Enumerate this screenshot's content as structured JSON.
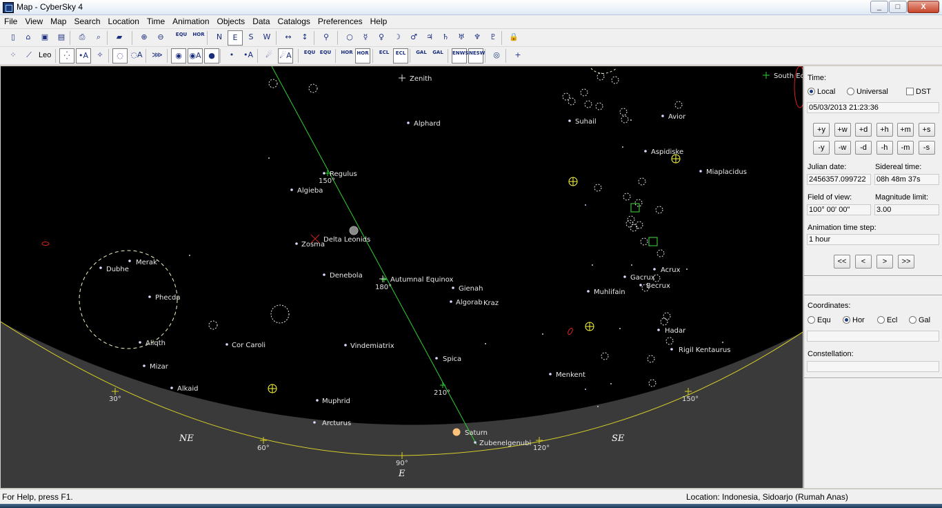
{
  "window": {
    "title": "Map - CyberSky 4",
    "minimize": "_",
    "maximize": "□",
    "close": "X"
  },
  "menu": [
    "File",
    "View",
    "Map",
    "Search",
    "Location",
    "Time",
    "Animation",
    "Objects",
    "Data",
    "Catalogs",
    "Preferences",
    "Help"
  ],
  "toolbar1": {
    "items": [
      {
        "name": "new-icon",
        "glyph": "▯"
      },
      {
        "name": "open-icon",
        "glyph": "⌂"
      },
      {
        "name": "save-icon",
        "glyph": "▣"
      },
      {
        "name": "save-all-icon",
        "glyph": "▤"
      },
      {
        "name": "print-icon",
        "glyph": "⎙"
      },
      {
        "name": "print-preview-icon",
        "glyph": "⌕"
      },
      {
        "name": "book-icon",
        "glyph": "▰"
      },
      {
        "name": "zoom-in-icon",
        "glyph": "⊕"
      },
      {
        "name": "zoom-out-icon",
        "glyph": "⊖"
      },
      {
        "name": "equ-dome-icon",
        "glyph": "EQU"
      },
      {
        "name": "hor-dome-icon",
        "glyph": "HOR"
      },
      {
        "name": "north-button",
        "glyph": "N"
      },
      {
        "name": "east-button",
        "glyph": "E"
      },
      {
        "name": "south-button",
        "glyph": "S"
      },
      {
        "name": "west-button",
        "glyph": "W"
      },
      {
        "name": "flip-horizontal-icon",
        "glyph": "↔"
      },
      {
        "name": "flip-vertical-icon",
        "glyph": "↕"
      },
      {
        "name": "telescope-icon",
        "glyph": "⚲"
      },
      {
        "name": "sun-icon",
        "glyph": "○"
      },
      {
        "name": "mercury-icon",
        "glyph": "☿"
      },
      {
        "name": "venus-icon",
        "glyph": "♀"
      },
      {
        "name": "moon-icon",
        "glyph": "☽"
      },
      {
        "name": "mars-icon",
        "glyph": "♂"
      },
      {
        "name": "jupiter-icon",
        "glyph": "♃"
      },
      {
        "name": "saturn-icon",
        "glyph": "♄"
      },
      {
        "name": "uranus-icon",
        "glyph": "♅"
      },
      {
        "name": "neptune-icon",
        "glyph": "♆"
      },
      {
        "name": "pluto-icon",
        "glyph": "♇"
      },
      {
        "name": "lock-icon",
        "glyph": "🔒"
      }
    ]
  },
  "toolbar2": {
    "constellation": "Leo",
    "items": [
      {
        "name": "constellation-lines-icon",
        "glyph": "⁘"
      },
      {
        "name": "constellation-line-icon",
        "glyph": "⟋"
      },
      {
        "name": "stars-icon",
        "glyph": "⁛"
      },
      {
        "name": "star-labels-icon",
        "glyph": "•A"
      },
      {
        "name": "star-names-icon",
        "glyph": "✧"
      },
      {
        "name": "deep-sky-icon",
        "glyph": "◌"
      },
      {
        "name": "deep-sky-labels-icon",
        "glyph": "◌A"
      },
      {
        "name": "milky-way-icon",
        "glyph": "⋙"
      },
      {
        "name": "planets-icon",
        "glyph": "◉"
      },
      {
        "name": "planet-labels-icon",
        "glyph": "◉A"
      },
      {
        "name": "planet-disk-icon",
        "glyph": "●"
      },
      {
        "name": "minor-planets-icon",
        "glyph": "•"
      },
      {
        "name": "minor-planet-labels-icon",
        "glyph": "•A"
      },
      {
        "name": "comets-icon",
        "glyph": "☄"
      },
      {
        "name": "comet-labels-icon",
        "glyph": "☄A"
      },
      {
        "name": "equ-grid-icon",
        "glyph": "EQU"
      },
      {
        "name": "equ-grid-labels-icon",
        "glyph": "EQU"
      },
      {
        "name": "hor-grid-icon",
        "glyph": "HOR"
      },
      {
        "name": "hor-grid-labels-icon",
        "glyph": "HOR"
      },
      {
        "name": "ecl-grid-icon",
        "glyph": "ECL"
      },
      {
        "name": "ecl-grid-labels-icon",
        "glyph": "ECL"
      },
      {
        "name": "gal-grid-icon",
        "glyph": "GAL"
      },
      {
        "name": "gal-grid-labels-icon",
        "glyph": "GAL"
      },
      {
        "name": "compass-icon",
        "glyph": "ENWS"
      },
      {
        "name": "nesw-labels-icon",
        "glyph": "NESW"
      },
      {
        "name": "target-icon",
        "glyph": "◎"
      },
      {
        "name": "crosshair-icon",
        "glyph": "+"
      }
    ]
  },
  "map": {
    "colors": {
      "sky": "#000000",
      "ground": "#3a3a3a",
      "horizon": "#d8d028",
      "ecliptic": "#2ed32e",
      "deepsky": "#ffffff",
      "marker": "#ffff40"
    },
    "stars": [
      {
        "name": "Zenith",
        "label": "Zenith"
      },
      {
        "name": "Alphard",
        "label": "Alphard"
      },
      {
        "name": "Regulus",
        "label": "Regulus"
      },
      {
        "name": "Algieba",
        "label": "Algieba"
      },
      {
        "name": "Zosma",
        "label": "Zosma"
      },
      {
        "name": "Delta Leonids",
        "label": "Delta Leonids"
      },
      {
        "name": "Merak",
        "label": "Merak"
      },
      {
        "name": "Dubhe",
        "label": "Dubhe"
      },
      {
        "name": "Phecda",
        "label": "Phecda"
      },
      {
        "name": "Denebola",
        "label": "Denebola"
      },
      {
        "name": "Autumnal Equinox",
        "label": "Autumnal Equinox"
      },
      {
        "name": "Gienah",
        "label": "Gienah"
      },
      {
        "name": "Algorab",
        "label": "Algorab"
      },
      {
        "name": "Kraz",
        "label": "Kraz"
      },
      {
        "name": "Alioth",
        "label": "Aliqth"
      },
      {
        "name": "Cor Caroli",
        "label": "Cor Caroli"
      },
      {
        "name": "Vindemiatrix",
        "label": "Vindemiatrix"
      },
      {
        "name": "Mizar",
        "label": "Mizar"
      },
      {
        "name": "Spica",
        "label": "Spica"
      },
      {
        "name": "Alkaid",
        "label": "Alkaid"
      },
      {
        "name": "Muphrid",
        "label": "Muphrid"
      },
      {
        "name": "Arcturus",
        "label": "Arcturus"
      },
      {
        "name": "Saturn",
        "label": "Saturn"
      },
      {
        "name": "Zubenelgenubi",
        "label": "Zubenelgenubi"
      },
      {
        "name": "Suhail",
        "label": "Suhail"
      },
      {
        "name": "Avior",
        "label": "Avior"
      },
      {
        "name": "Aspidiske",
        "label": "Aspidiske"
      },
      {
        "name": "Miaplacidus",
        "label": "Miaplacidus"
      },
      {
        "name": "Acrux",
        "label": "Acrux"
      },
      {
        "name": "Gacrux",
        "label": "Gacrux"
      },
      {
        "name": "Becrux",
        "label": "Becrux"
      },
      {
        "name": "Muhlifain",
        "label": "Muhlifain"
      },
      {
        "name": "Hadar",
        "label": "Hadar"
      },
      {
        "name": "Rigil Kentaurus",
        "label": "Rigil Kentaurus"
      },
      {
        "name": "Menkent",
        "label": "Menkent"
      },
      {
        "name": "South Ecliptic Pole",
        "label": "South Ec"
      }
    ],
    "ecliptic_labels": [
      "150°",
      "180°",
      "210°"
    ],
    "azimuth_labels": [
      "30°",
      "60°",
      "90°",
      "120°",
      "150°"
    ],
    "directions": [
      "NE",
      "E",
      "SE"
    ]
  },
  "panel": {
    "time_label": "Time:",
    "local": "Local",
    "universal": "Universal",
    "dst": "DST",
    "datetime": "05/03/2013 21:23:36",
    "step_plus": [
      "+y",
      "+w",
      "+d",
      "+h",
      "+m",
      "+s"
    ],
    "step_minus": [
      "-y",
      "-w",
      "-d",
      "-h",
      "-m",
      "-s"
    ],
    "julian_label": "Julian date:",
    "julian_value": "2456357.099722",
    "sidereal_label": "Sidereal time:",
    "sidereal_value": "08h 48m 37s",
    "fov_label": "Field of view:",
    "fov_value": "100° 00' 00\"",
    "maglimit_label": "Magnitude limit:",
    "maglimit_value": "3.00",
    "anim_label": "Animation time step:",
    "anim_value": "1 hour",
    "anim_buttons": [
      "<<",
      "<",
      ">",
      ">>"
    ],
    "coords_label": "Coordinates:",
    "coords": [
      "Equ",
      "Hor",
      "Ecl",
      "Gal"
    ],
    "coords_value": "",
    "constellation_label": "Constellation:",
    "constellation_value": ""
  },
  "status": {
    "help": "For Help, press F1.",
    "location": "Location: Indonesia, Sidoarjo (Rumah Anas)"
  }
}
